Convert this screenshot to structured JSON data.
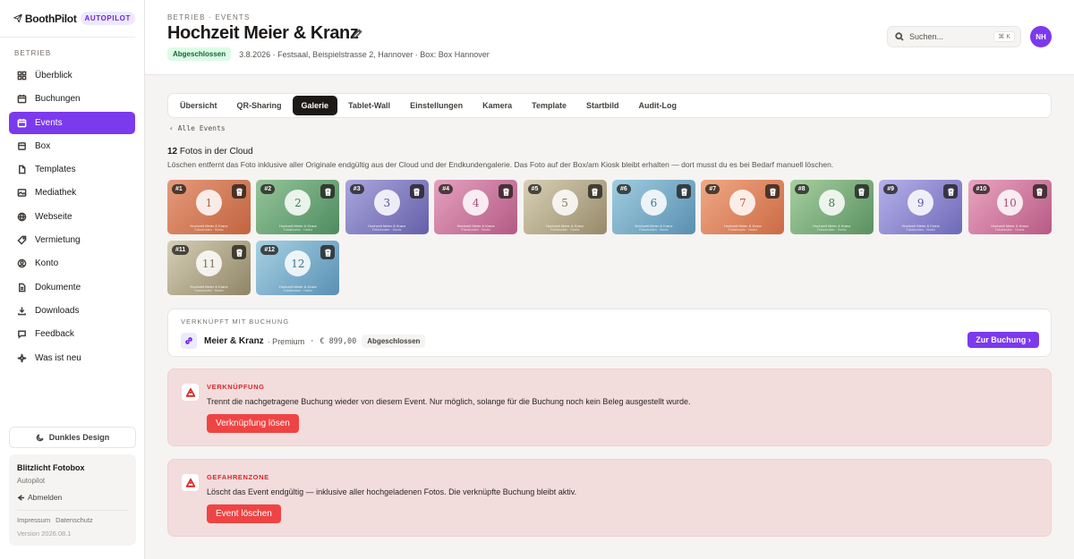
{
  "brand": {
    "name": "BoothPilot",
    "badge": "AUTOPILOT"
  },
  "sidebar": {
    "section": "BETRIEB",
    "items": [
      {
        "label": "Überblick",
        "icon": "grid-icon",
        "active": false
      },
      {
        "label": "Buchungen",
        "icon": "calendar-icon",
        "active": false
      },
      {
        "label": "Events",
        "icon": "calendar-icon",
        "active": true
      },
      {
        "label": "Box",
        "icon": "box-icon",
        "active": false
      },
      {
        "label": "Templates",
        "icon": "file-icon",
        "active": false
      },
      {
        "label": "Mediathek",
        "icon": "image-icon",
        "active": false
      },
      {
        "label": "Webseite",
        "icon": "globe-icon",
        "active": false
      },
      {
        "label": "Vermietung",
        "icon": "tag-icon",
        "active": false
      },
      {
        "label": "Konto",
        "icon": "user-circle-icon",
        "active": false
      },
      {
        "label": "Dokumente",
        "icon": "document-icon",
        "active": false
      },
      {
        "label": "Downloads",
        "icon": "download-icon",
        "active": false
      },
      {
        "label": "Feedback",
        "icon": "chat-icon",
        "active": false
      },
      {
        "label": "Was ist neu",
        "icon": "sparkle-icon",
        "active": false
      }
    ],
    "dark_mode_label": "Dunkles Design",
    "account": {
      "name": "Blitzlicht Fotobox",
      "plan": "Autopilot",
      "logout": "Abmelden",
      "imprint": "Impressum",
      "privacy": "Datenschutz",
      "version": "Version 2026.08.1"
    }
  },
  "header": {
    "breadcrumb": "BETRIEB · EVENTS",
    "title": "Hochzeit Meier & Kranz",
    "status": "Abgeschlossen",
    "meta": "3.8.2026 · Festsaal, Beispielstrasse 2, Hannover · Box: Box Hannover",
    "search_placeholder": "Suchen...",
    "search_shortcut": "⌘ K",
    "avatar_initials": "NH"
  },
  "tabs": [
    {
      "label": "Übersicht",
      "active": false
    },
    {
      "label": "QR-Sharing",
      "active": false
    },
    {
      "label": "Galerie",
      "active": true
    },
    {
      "label": "Tablet-Wall",
      "active": false
    },
    {
      "label": "Einstellungen",
      "active": false
    },
    {
      "label": "Kamera",
      "active": false
    },
    {
      "label": "Template",
      "active": false
    },
    {
      "label": "Startbild",
      "active": false
    },
    {
      "label": "Audit-Log",
      "active": false
    }
  ],
  "gallery": {
    "back": "‹ Alle Events",
    "count": "12",
    "count_suffix": " Fotos in der Cloud",
    "description": "Löschen entfernt das Foto inklusive aller Originale endgültig aus der Cloud und der Endkundengalerie. Das Foto auf der Box/am Kiosk bleibt erhalten — dort musst du es bei Bedarf manuell löschen.",
    "caption1": "Hochzeit Meier & Kranz",
    "caption2": "Fotoshooten · Hochz",
    "photos": [
      {
        "badge": "#1",
        "number": "1",
        "c1": "#e59a7b",
        "c2": "#c2643f",
        "ink": "#b45a3c"
      },
      {
        "badge": "#2",
        "number": "2",
        "c1": "#95c49a",
        "c2": "#4d8c5f",
        "ink": "#3f7a50"
      },
      {
        "badge": "#3",
        "number": "3",
        "c1": "#a9a6dd",
        "c2": "#6560a9",
        "ink": "#55509a"
      },
      {
        "badge": "#4",
        "number": "4",
        "c1": "#e4a1bf",
        "c2": "#b45a84",
        "ink": "#a64a76"
      },
      {
        "badge": "#5",
        "number": "5",
        "c1": "#d8d0b6",
        "c2": "#978a6a",
        "ink": "#857858"
      },
      {
        "badge": "#6",
        "number": "6",
        "c1": "#9fcde0",
        "c2": "#5a8fb0",
        "ink": "#3f779c"
      },
      {
        "badge": "#7",
        "number": "7",
        "c1": "#f0a985",
        "c2": "#cc6a45",
        "ink": "#c05a38"
      },
      {
        "badge": "#8",
        "number": "8",
        "c1": "#a7cf9f",
        "c2": "#5a9162",
        "ink": "#3e7a4a"
      },
      {
        "badge": "#9",
        "number": "9",
        "c1": "#b5b1ea",
        "c2": "#6e69b8",
        "ink": "#5a55a6"
      },
      {
        "badge": "#10",
        "number": "10",
        "c1": "#e9a4c0",
        "c2": "#b85a84",
        "ink": "#a84c74"
      },
      {
        "badge": "#11",
        "number": "11",
        "c1": "#d6cfb5",
        "c2": "#8f8466",
        "ink": "#7d7254"
      },
      {
        "badge": "#12",
        "number": "12",
        "c1": "#a6d1e3",
        "c2": "#5a90b4",
        "ink": "#3c7599"
      }
    ]
  },
  "linked": {
    "label": "VERKNÜPFT MIT BUCHUNG",
    "name": "Meier & Kranz",
    "plan": "· Premium",
    "sep": "·",
    "price": "€ 899,00",
    "status": "Abgeschlossen",
    "button": "Zur Buchung ›"
  },
  "unlink": {
    "label": "VERKNÜPFUNG",
    "text": "Trennt die nachgetragene Buchung wieder von diesem Event. Nur möglich, solange für die Buchung noch kein Beleg ausgestellt wurde.",
    "button": "Verknüpfung lösen"
  },
  "danger": {
    "label": "GEFAHRENZONE",
    "text": "Löscht das Event endgültig — inklusive aller hochgeladenen Fotos. Die verknüpfte Buchung bleibt aktiv.",
    "button": "Event löschen"
  },
  "colors": {
    "accent": "#7c3aed",
    "danger": "#ef4444",
    "success_bg": "#dcfce7"
  }
}
